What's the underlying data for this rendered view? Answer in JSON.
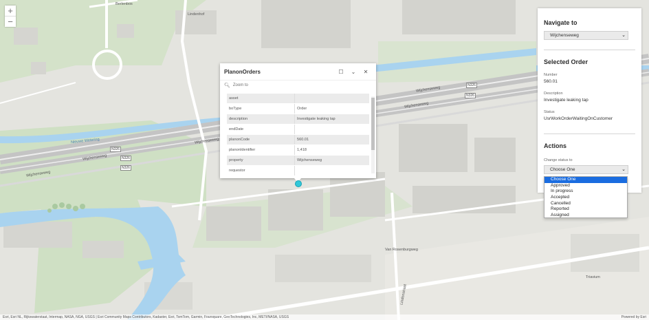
{
  "map": {
    "zoom_in": "+",
    "zoom_out": "−",
    "labels": {
      "lindenhof": "Lindenhof",
      "berlenbos": "Berlenbos",
      "wijchenseweg_1": "Wijchenseweg",
      "wijchenseweg_2": "Wijchenseweg",
      "wijchenseweg_3": "Wijchenseweg",
      "wijchenseweg_4": "Wijchenseweg",
      "wijchenseweg_5": "Wijchenseweg",
      "nieuwe_wetering": "Nieuwe Wetering",
      "van_rosenburgweg": "Van Rosenburgweg",
      "triavium": "Triavium",
      "lindenstraat": "Lindenstraat"
    },
    "shields": [
      "N326",
      "N326",
      "N326",
      "N326",
      "N326"
    ]
  },
  "popup": {
    "title": "PlanonOrders",
    "maximize_icon": "☐",
    "collapse_icon": "⌄",
    "close_icon": "✕",
    "zoom_to_label": "Zoom to",
    "attributes": [
      {
        "key": "asset",
        "value": ""
      },
      {
        "key": "boType",
        "value": "Order"
      },
      {
        "key": "description",
        "value": "Investigate leaking tap"
      },
      {
        "key": "endDate",
        "value": ""
      },
      {
        "key": "planonCode",
        "value": "560.01"
      },
      {
        "key": "planonIdentifier",
        "value": "1,418"
      },
      {
        "key": "property",
        "value": "Wijchenseweg"
      },
      {
        "key": "requestor",
        "value": ""
      }
    ]
  },
  "panel": {
    "navigate_title": "Navigate to",
    "navigate_value": "Wijchenseweg",
    "selected_title": "Selected Order",
    "number_label": "Number",
    "number_value": "560.01",
    "description_label": "Description",
    "description_value": "Investigate leaking tap",
    "status_label": "Status",
    "status_value": "UsrWorkOrderWaitingOnCustomer",
    "actions_title": "Actions",
    "change_status_label": "Change status to",
    "change_status_value": "Choose One",
    "options": [
      "Choose One",
      "Approved",
      "In progress",
      "Accepted",
      "Cancelled",
      "Reported",
      "Assigned"
    ]
  },
  "attribution": {
    "left": "Esri, Esri NL, Rijkswaterstaat, Intermap, NASA, NGA, USGS | Esri Community Maps Contributors, Kadaster, Esri, TomTom, Garmin, Foursquare, GeoTechnologies, Inc, METI/NASA, USGS",
    "right": "Powered by Esri"
  },
  "colors": {
    "land": "#e4e4df",
    "green": "#cfe0c4",
    "water": "#a9d3ef",
    "road": "#c9c9c9",
    "highlight": "#1a6ce0",
    "marker": "#31c8d9"
  }
}
